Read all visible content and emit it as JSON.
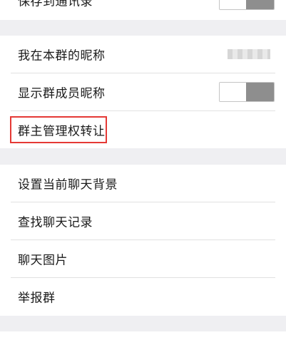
{
  "settings": {
    "save_to_contacts_label": "保存到通讯录",
    "group_nickname_label": "我在本群的昵称",
    "group_nickname_value": "",
    "show_member_nickname_label": "显示群成员昵称",
    "transfer_owner_label": "群主管理权转让",
    "chat_background_label": "设置当前聊天背景",
    "search_history_label": "查找聊天记录",
    "chat_images_label": "聊天图片",
    "report_label": "举报群"
  },
  "toggles": {
    "save_to_contacts": "off",
    "show_member_nickname": "off"
  },
  "colors": {
    "highlight_border": "#e53935",
    "toggle_track": "#8e8e8e",
    "page_background": "#efeff2"
  }
}
